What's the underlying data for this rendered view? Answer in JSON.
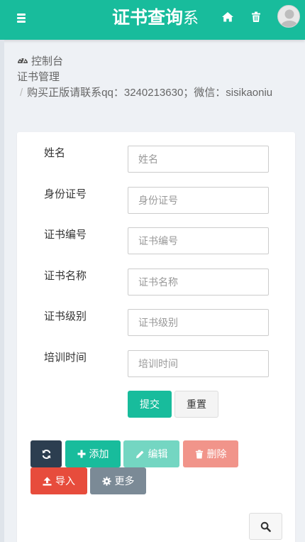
{
  "header": {
    "title_strong": "证书查询",
    "title_light": "系",
    "background": "#18bc9c",
    "icons": [
      "menu-icon",
      "home-icon",
      "trash-icon",
      "user-avatar"
    ]
  },
  "breadcrumb": {
    "dashboard": "控制台",
    "section": "证书管理",
    "separator": "/",
    "notice": "购买正版请联系qq：3240213630；微信：sisikaoniu"
  },
  "form": {
    "fields": [
      {
        "label": "姓名",
        "placeholder": "姓名",
        "value": ""
      },
      {
        "label": "身份证号",
        "placeholder": "身份证号",
        "value": ""
      },
      {
        "label": "证书编号",
        "placeholder": "证书编号",
        "value": ""
      },
      {
        "label": "证书名称",
        "placeholder": "证书名称",
        "value": ""
      },
      {
        "label": "证书级别",
        "placeholder": "证书级别",
        "value": ""
      },
      {
        "label": "培训时间",
        "placeholder": "培训时间",
        "value": ""
      }
    ],
    "submit_label": "提交",
    "reset_label": "重置"
  },
  "toolbar": {
    "add_label": "添加",
    "edit_label": "编辑",
    "delete_label": "删除",
    "import_label": "导入",
    "more_label": "更多"
  },
  "colors": {
    "primary": "#18bc9c",
    "dark": "#2c3e50",
    "danger": "#e74c3c",
    "gray": "#7b8a96"
  }
}
